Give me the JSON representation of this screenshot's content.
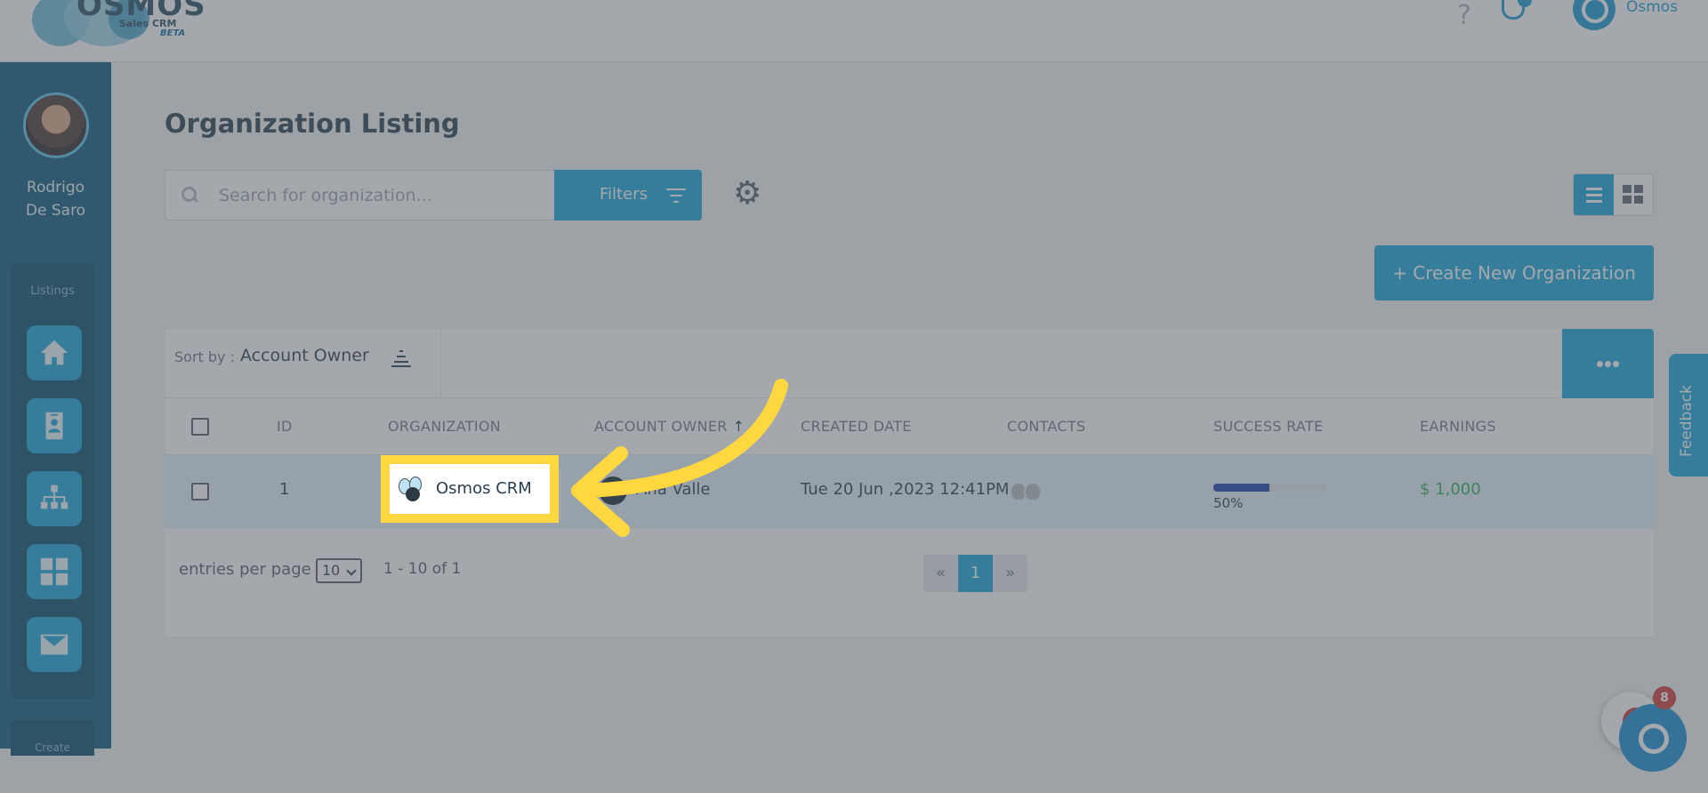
{
  "header": {
    "brand": "OSMOS",
    "brand_sub": "Sales CRM",
    "brand_tag": "BETA",
    "help_glyph": "?",
    "user_name": "Osmos"
  },
  "sidebar": {
    "user_name_line1": "Rodrigo",
    "user_name_line2": "De Saro",
    "section_label": "Listings",
    "items": [
      {
        "icon": "home-icon"
      },
      {
        "icon": "contact-card-icon"
      },
      {
        "icon": "org-chart-icon"
      },
      {
        "icon": "grid-icon"
      },
      {
        "icon": "mail-icon"
      }
    ],
    "section2_label": "Create"
  },
  "page": {
    "title": "Organization Listing",
    "search_placeholder": "Search for organization...",
    "filters_label": "Filters",
    "settings_glyph": "⚙",
    "create_label": "+ Create New Organization"
  },
  "table": {
    "sort_label": "Sort by :",
    "sort_value": "Account Owner",
    "more_glyph": "•••",
    "columns": {
      "id": "ID",
      "organization": "ORGANIZATION",
      "account_owner": "ACCOUNT OWNER",
      "created_date": "CREATED DATE",
      "contacts": "CONTACTS",
      "success_rate": "SUCCESS RATE",
      "earnings": "EARNINGS"
    },
    "sort_arrow": "↑",
    "rows": [
      {
        "id": "1",
        "organization": "Osmos CRM",
        "account_owner": "Ana Valle",
        "created_date": "Tue 20 Jun ,2023 12:41PM",
        "success_rate": 0.5,
        "success_label": "50%",
        "earnings": "$ 1,000"
      }
    ],
    "entries_label": "entries per page",
    "entries_value": "10",
    "range_text": "1 - 10 of 1",
    "pager_prev": "«",
    "pager_page": "1",
    "pager_next": "»"
  },
  "feedback_label": "Feedback",
  "chat_badge": "8",
  "colors": {
    "accent": "#1aa3dc",
    "sidebar": "#0d5a80",
    "highlight": "#ffd740",
    "earnings": "#2eaf5a"
  }
}
